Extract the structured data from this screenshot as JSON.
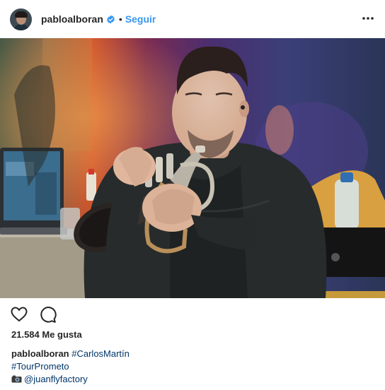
{
  "header": {
    "username": "pabloalboran",
    "separator": "•",
    "follow_label": "Seguir"
  },
  "icons": {
    "verified": "verified-badge-icon",
    "more": "more-options-icon",
    "like": "heart-icon",
    "comment": "comment-bubble-icon",
    "camera": "camera-emoji-icon"
  },
  "colors": {
    "link_blue": "#3897f0",
    "hashtag_blue": "#003569",
    "text": "#262626"
  },
  "likes": {
    "text": "21.584 Me gusta"
  },
  "caption": {
    "username": "pabloalboran",
    "hashtag_1": "#CarlosMartín",
    "hashtag_2": "#TourPrometo",
    "mention": "@juanflyfactory"
  }
}
